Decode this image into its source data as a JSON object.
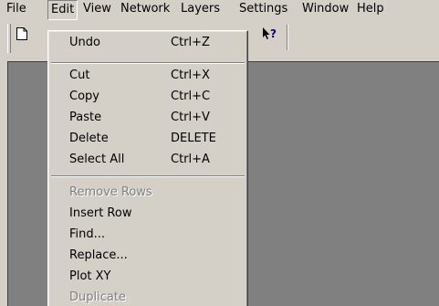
{
  "menubar": {
    "items": [
      "File",
      "Edit",
      "View",
      "Network",
      "Layers",
      "Settings",
      "Window",
      "Help"
    ],
    "open_menu": "Edit"
  },
  "toolbar": {
    "icons": [
      "new-document-icon",
      "context-help-icon"
    ]
  },
  "edit_menu": {
    "undo": {
      "label": "Undo",
      "shortcut": "Ctrl+Z"
    },
    "cut": {
      "label": "Cut",
      "shortcut": "Ctrl+X"
    },
    "copy": {
      "label": "Copy",
      "shortcut": "Ctrl+C"
    },
    "paste": {
      "label": "Paste",
      "shortcut": "Ctrl+V"
    },
    "delete": {
      "label": "Delete",
      "shortcut": "DELETE"
    },
    "select_all": {
      "label": "Select All",
      "shortcut": "Ctrl+A"
    },
    "remove_rows": {
      "label": "Remove Rows",
      "enabled": false
    },
    "insert_row": {
      "label": "Insert Row"
    },
    "find": {
      "label": "Find..."
    },
    "replace": {
      "label": "Replace..."
    },
    "plot_xy": {
      "label": "Plot XY"
    },
    "duplicate": {
      "label": "Duplicate",
      "enabled": false
    }
  },
  "colors": {
    "face": "#d4d0c8",
    "client_background": "#808080",
    "disabled_text": "#808080"
  }
}
